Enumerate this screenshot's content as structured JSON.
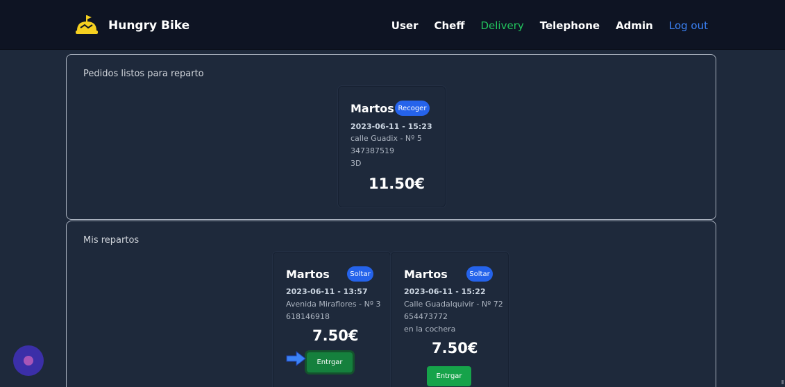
{
  "brand": {
    "name": "Hungry Bike",
    "logo_icon": "burger-bell-icon"
  },
  "nav": {
    "items": [
      {
        "label": "User"
      },
      {
        "label": "Cheff"
      },
      {
        "label": "Delivery",
        "active": true
      },
      {
        "label": "Telephone"
      },
      {
        "label": "Admin"
      },
      {
        "label": "Log out"
      }
    ]
  },
  "ready_panel": {
    "title": "Pedidos listos para reparto",
    "orders": [
      {
        "name": "Martos",
        "badge": "Recoger",
        "datetime": "2023-06-11 - 15:23",
        "address": "calle Guadix - Nº 5",
        "phone": "347387519",
        "note": "3D",
        "price": "11.50€"
      }
    ]
  },
  "my_panel": {
    "title": "Mis repartos",
    "orders": [
      {
        "name": "Martos",
        "badge": "Soltar",
        "datetime": "2023-06-11 - 13:57",
        "address": "Avenida Miraflores - Nº 3",
        "phone": "618146918",
        "price": "7.50€",
        "action": "Entrgar"
      },
      {
        "name": "Martos",
        "badge": "Soltar",
        "datetime": "2023-06-11 - 15:22",
        "address": "Calle Guadalquivir - Nº 72",
        "phone": "654473772",
        "note": "en la cochera",
        "price": "7.50€",
        "action": "Entrgar"
      }
    ]
  },
  "colors": {
    "background": "#1e293b",
    "navbar": "#0e1423",
    "active_nav": "#22c55e",
    "logout": "#3b82f6",
    "badge": "#2563eb",
    "deliver_button": "#16a34a"
  },
  "annotation": {
    "icon": "arrow-right-icon"
  },
  "floating_button": {
    "icon": "chat-bubble-icon"
  }
}
